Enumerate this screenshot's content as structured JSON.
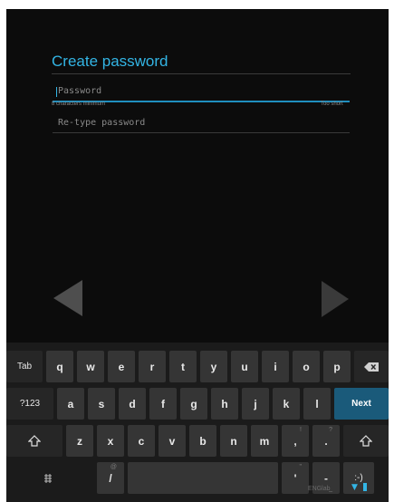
{
  "form": {
    "title": "Create password",
    "password_placeholder": "Password",
    "hint_min": "8 characters minimum",
    "hint_strength": "Too short",
    "retype_placeholder": "Re-type password"
  },
  "keyboard": {
    "row1": [
      "Tab",
      "q",
      "w",
      "e",
      "r",
      "t",
      "y",
      "u",
      "i",
      "o",
      "p"
    ],
    "row2": [
      "?123",
      "a",
      "s",
      "d",
      "f",
      "g",
      "h",
      "j",
      "k",
      "l",
      "Next"
    ],
    "row3": [
      "z",
      "x",
      "c",
      "v",
      "b",
      "n",
      "m",
      ",",
      "."
    ],
    "row3_sup": {
      "comma": "!",
      "period": "?"
    },
    "row4": {
      "slash": "/",
      "slash_sup": "@",
      "quote": "'",
      "quote_sup": "\"",
      "dash": "-",
      "dash_sub": "_",
      "smiley": ":-)"
    }
  },
  "status": {
    "label": "ENGlab"
  },
  "icons": [
    "backspace-icon",
    "shift-icon",
    "settings-icon",
    "wifi-icon",
    "battery-icon",
    "back-arrow-icon",
    "next-arrow-icon"
  ]
}
